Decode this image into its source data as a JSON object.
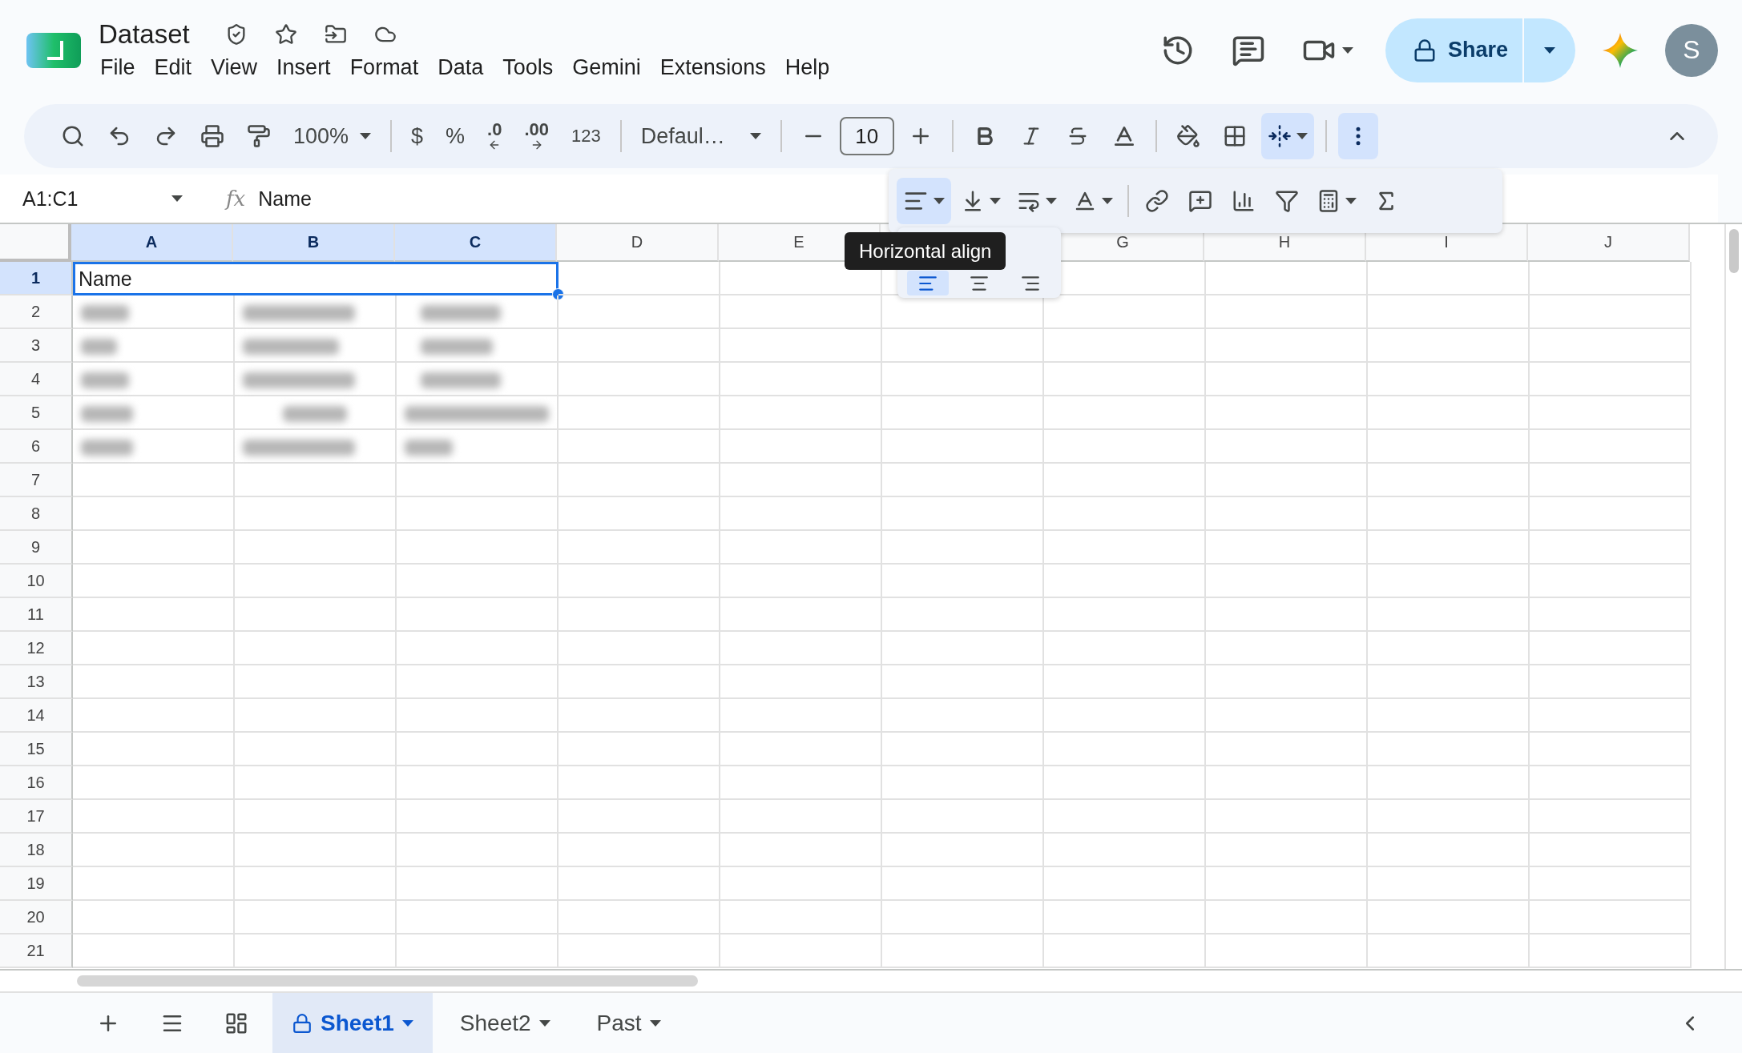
{
  "document": {
    "title": "Dataset"
  },
  "menu": [
    "File",
    "Edit",
    "View",
    "Insert",
    "Format",
    "Data",
    "Tools",
    "Gemini",
    "Extensions",
    "Help"
  ],
  "share": {
    "label": "Share"
  },
  "avatar": {
    "initial": "S"
  },
  "toolbar": {
    "zoom": "100%",
    "currency": "$",
    "percent": "%",
    "decrease_decimal": ".0",
    "increase_decimal": ".00",
    "number_format": "123",
    "font": "Defaul…",
    "font_size": "10",
    "merge_selected": true,
    "more_open": true
  },
  "floating_toolbar": {
    "align_open": true
  },
  "align_options": [
    {
      "selected": true
    },
    {
      "selected": false
    },
    {
      "selected": false
    }
  ],
  "tooltip": "Horizontal align",
  "formula_bar": {
    "name_box": "A1:C1",
    "fx_label": "fx",
    "formula": "Name"
  },
  "columns": [
    {
      "label": "A",
      "selected": true
    },
    {
      "label": "B",
      "selected": true
    },
    {
      "label": "C",
      "selected": true
    },
    {
      "label": "D",
      "selected": false
    },
    {
      "label": "E",
      "selected": false
    },
    {
      "selected": false
    },
    {
      "label": "G",
      "selected": false
    },
    {
      "label": "H",
      "selected": false
    },
    {
      "label": "I",
      "selected": false
    },
    {
      "label": "J",
      "selected": false
    }
  ],
  "rows": [
    {
      "label": "1",
      "selected": true
    },
    {
      "label": "2",
      "selected": false
    },
    {
      "label": "3",
      "selected": false
    },
    {
      "label": "4",
      "selected": false
    },
    {
      "label": "5",
      "selected": false
    },
    {
      "label": "6",
      "selected": false
    },
    {
      "label": "7",
      "selected": false
    },
    {
      "label": "8",
      "selected": false
    },
    {
      "label": "9",
      "selected": false
    },
    {
      "label": "10",
      "selected": false
    },
    {
      "label": "11",
      "selected": false
    },
    {
      "label": "12",
      "selected": false
    },
    {
      "label": "13",
      "selected": false
    },
    {
      "label": "14",
      "selected": false
    },
    {
      "label": "15",
      "selected": false
    },
    {
      "label": "16",
      "selected": false
    },
    {
      "label": "17",
      "selected": false
    },
    {
      "label": "18",
      "selected": false
    },
    {
      "label": "19",
      "selected": false
    },
    {
      "label": "20",
      "selected": false
    },
    {
      "label": "21",
      "selected": false
    }
  ],
  "cell_a1": "Name",
  "sheets": [
    {
      "label": "Sheet1",
      "selected": true,
      "locked": true
    },
    {
      "label": "Sheet2",
      "selected": false,
      "locked": false
    },
    {
      "label": "Past",
      "selected": false,
      "locked": false
    }
  ]
}
